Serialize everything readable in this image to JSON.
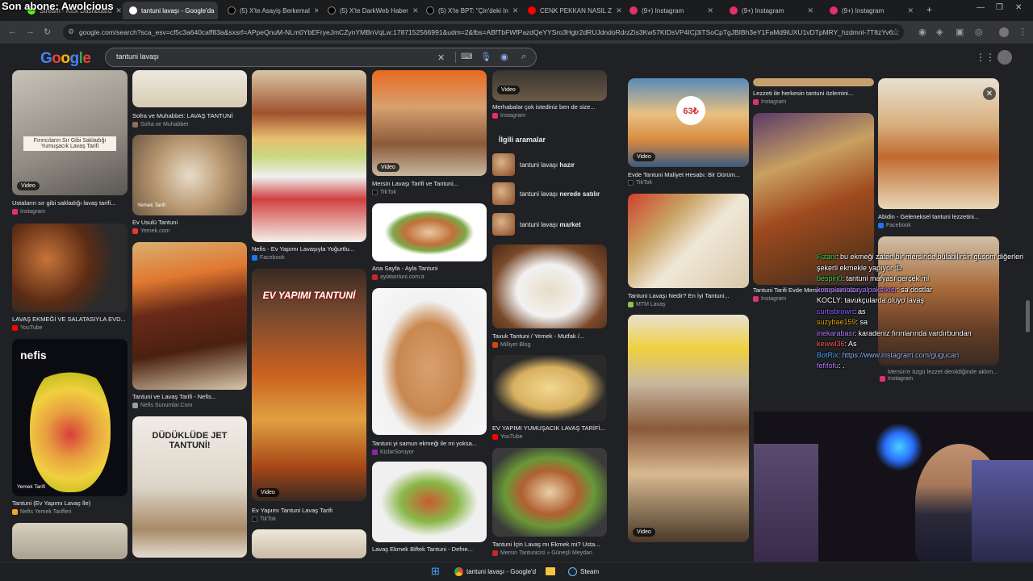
{
  "overlay": {
    "stream_title": "Son abone: Awolcious"
  },
  "tabs": [
    {
      "label": "Stream - Kick Dashboard",
      "color": "#53fc18"
    },
    {
      "label": "tantuni lavaşı - Google'da",
      "color": "#ffffff",
      "active": true
    },
    {
      "label": "(5) X'te Asayiş Berkemal",
      "color": "#ffffff"
    },
    {
      "label": "(5) X'te DarkWeb Haber",
      "color": "#ffffff"
    },
    {
      "label": "(5) X'te BPT: \"Çin'deki In",
      "color": "#ffffff"
    },
    {
      "label": "CENK PEKKAN NASIL Z",
      "color": "#ff0000"
    },
    {
      "label": "(9+) Instagram",
      "color": "#e1306c"
    },
    {
      "label": "(9+) Instagram",
      "color": "#e1306c"
    },
    {
      "label": "(9+) Instagram",
      "color": "#e1306c"
    }
  ],
  "address_bar": {
    "url": "google.com/search?sca_esv=cf5c3a640caff83a&sxsrf=APpeQnuM-NLm0YbEFryeJmCZynYMBnVqLw:1787152566991&udm=2&fbs=ABfTbFWfPazdQeYYSro3Hgtr2dRUJdndoRdrzZis3Kw57KIDsVP4ICj3iTSoCpTgJBIBh3eY1FaMd9iUXU1vDTpMRY_hzdmnl-7T8zYv6..."
  },
  "google": {
    "logo": "Google",
    "search_query": "tantuni lavaşı",
    "logo_colors": [
      "#4285f4",
      "#ea4335",
      "#fbbc05",
      "#4285f4",
      "#34a853",
      "#ea4335"
    ]
  },
  "results": [
    {
      "caption": "Ustaların sır gibi sakladığı lavaş tarifi...",
      "source": "Instagram",
      "badge": "Video",
      "overlay_text": "Fırıncıların Sır Gibi Sakladığı Yumuşacık Lavaş Tarifi"
    },
    {
      "caption": "LAVAŞ EKMEĞİ VE SALATASIYLA EVD...",
      "source": "YouTube"
    },
    {
      "caption": "Tantuni (Ev Yapımı Lavaş İle)",
      "source": "Nefis Yemek Tarifleri",
      "overlay_text": "nefis yemek tarifleri",
      "tag": "Yemek Tarifi"
    },
    {
      "caption": "Sofra ve Muhabbet: LAVAŞ TANTUNİ",
      "source": "Sofra ve Muhabbet"
    },
    {
      "caption": "Ev Usulü Tantuni",
      "source": "Yemek.com",
      "tag": "Yemek Tarifi"
    },
    {
      "caption": "Tantuni ve Lavaş Tarifi - Nefis...",
      "source": "Nefis Sunumlar.Com"
    },
    {
      "caption": "",
      "source": "",
      "overlay_text": "DÜDÜKLÜDE JET TANTUNİ!"
    },
    {
      "caption": "Nefis - Ev Yapımı Lavaşıyla Yoğurtlu...",
      "source": "Facebook"
    },
    {
      "caption": "Ev Yapımı Tantuni Lavaş Tarifi",
      "source": "TikTok",
      "badge": "Video",
      "overlay_text": "EV YAPIMI TANTUNİ"
    },
    {
      "caption": "Mersin Lavaşı Tarifi ve Tantuni...",
      "source": "TikTok",
      "badge": "Video"
    },
    {
      "caption": "Ana Sayfa - Ayla Tantuni",
      "source": "aylatantuni.com.tr"
    },
    {
      "caption": "Tantuni yi samun ekmeği ile mi yoksa...",
      "source": "KizlarSoruyor"
    },
    {
      "caption": "Lavaş Ekmek Biftek Tantuni - Defne...",
      "source": ""
    },
    {
      "caption": "Merhabalar çok istediniz ben de size...",
      "source": "Instagram",
      "badge": "Video"
    },
    {
      "caption": "Tavuk Tantuni / Yemek - Mutfak /...",
      "source": "Milliyet Blog"
    },
    {
      "caption": "EV YAPIMI YUMUŞACIK LAVAŞ TARİFİ...",
      "source": "YouTube"
    },
    {
      "caption": "Tantuni İçin Lavaş mı Ekmek mi? Usta...",
      "source": "Mersin Tantunicisi » Güneşli Meydan"
    },
    {
      "caption": "Evde Tantuni Maliyet Hesabı: Bir Dürüm...",
      "source": "TikTok",
      "badge": "Video",
      "overlay_text": "63₺"
    },
    {
      "caption": "Tantuni Lavaşı Nedir? En İyi Tantuni...",
      "source": "MTM Lavaş"
    },
    {
      "caption": "",
      "source": "",
      "badge": "Video"
    },
    {
      "caption": "Lezzeti ile herkesin tantuni özlemini...",
      "source": "Instagram"
    },
    {
      "caption": "Tantuni Tarifi Evde Mersin lezzetini loku...",
      "source": "Instagram"
    },
    {
      "caption": "Abidin - Geleneksel tantuni lezzetini...",
      "source": "Facebook"
    },
    {
      "caption": "Mersin'e özgü lezzet denildiğinde aklım...",
      "source": "Instagram"
    }
  ],
  "related": {
    "title": "İlgili aramalar",
    "items": [
      {
        "prefix": "tantuni lavaşı ",
        "bold": "hazır"
      },
      {
        "prefix": "tantuni lavaşı ",
        "bold": "nerede satılır"
      },
      {
        "prefix": "tantuni lavaşı ",
        "bold": "market"
      }
    ]
  },
  "chat": [
    {
      "user": "Fizani",
      "color": "#3ad65c",
      "text": ": bu ekmeği zaten bir mersinde bulabilirsin gusom diğerleri şekerli ekmekle yapıyor :D"
    },
    {
      "user": "bespin0",
      "color": "#3ad65c",
      "text": ": tantuni mafyası gerçek mi"
    },
    {
      "user": "komplemotoryalpaksıkıcı",
      "color": "#b37aff",
      "text": ": sa dostlar"
    },
    {
      "user": "KOCLY",
      "color": "#ffffff",
      "text": ": tavukçularda oluyo lavaş"
    },
    {
      "user": "curtisbrown",
      "color": "#8a5cff",
      "text": ": as"
    },
    {
      "user": "suzybae159",
      "color": "#e0a000",
      "text": ": sa"
    },
    {
      "user": "inekarabası",
      "color": "#b37aff",
      "text": ": karadeniz fırınlarında vardırbundan"
    },
    {
      "user": "kewwl36",
      "color": "#ff5555",
      "text": ": As"
    },
    {
      "user": "BotRix",
      "color": "#4aa3ff",
      "text": ": https://www.instagram.com/gugucan"
    },
    {
      "user": "fefifofu",
      "color": "#b37aff",
      "text": ": ."
    }
  ],
  "taskbar": {
    "items": [
      {
        "label": ""
      },
      {
        "label": "tantuni lavaşı - Google'd"
      },
      {
        "label": ""
      },
      {
        "label": "Steam"
      }
    ]
  }
}
